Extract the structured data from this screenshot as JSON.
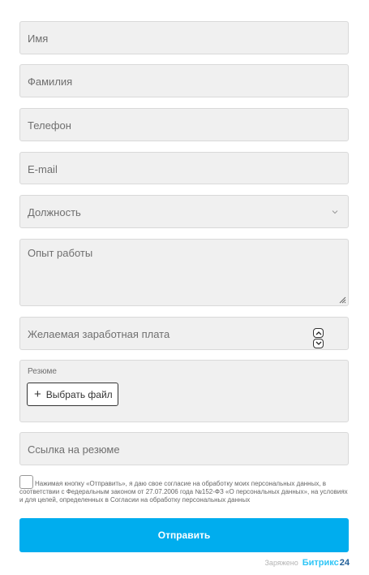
{
  "form": {
    "name_placeholder": "Имя",
    "surname_placeholder": "Фамилия",
    "phone_placeholder": "Телефон",
    "email_placeholder": "E-mail",
    "position_placeholder": "Должность",
    "experience_placeholder": "Опыт работы",
    "salary_placeholder": "Желаемая заработная плата",
    "resume_label": "Резюме",
    "file_button_label": "Выбрать файл",
    "resume_link_placeholder": "Ссылка на резюме",
    "consent_text": "Нажимая кнопку «Отправить», я даю свое согласие на обработку моих персональных данных, в соответствии с Федеральным законом от 27.07.2006 года №152-ФЗ «О персональных данных», на условиях и для целей, определенных в Согласии на обработку персональных данных",
    "consent_checked": false,
    "submit_label": "Отправить"
  },
  "footer": {
    "prefix": "Заряжено",
    "brand": "Битрикс",
    "brand_number": "24"
  },
  "colors": {
    "accent": "#00adee",
    "field_bg": "#f0f0f0",
    "brand": "#2fc6f6",
    "brand_number": "#215f98"
  },
  "icons": {
    "select_arrow": "chevron-down-icon",
    "spinner_up": "chevron-up-icon",
    "spinner_down": "chevron-down-icon",
    "file_add": "plus-icon",
    "resize": "resize-handle-icon"
  }
}
